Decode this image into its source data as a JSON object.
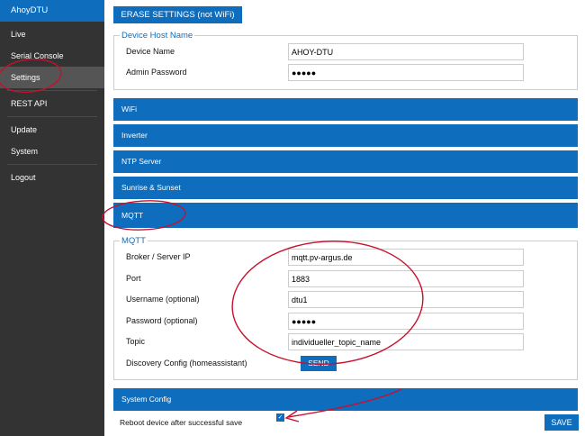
{
  "sidebar": {
    "brand": "AhoyDTU",
    "items": [
      {
        "label": "Live"
      },
      {
        "label": "Serial Console"
      },
      {
        "label": "Settings"
      },
      {
        "label": "REST API"
      },
      {
        "label": "Update"
      },
      {
        "label": "System"
      },
      {
        "label": "Logout"
      }
    ]
  },
  "toolbar": {
    "erase_label": "ERASE SETTINGS (not WiFi)"
  },
  "device": {
    "legend": "Device Host Name",
    "name_label": "Device Name",
    "name_value": "AHOY-DTU",
    "password_label": "Admin Password",
    "password_value": "●●●●●"
  },
  "sections": {
    "wifi": "WiFi",
    "inverter": "Inverter",
    "ntp": "NTP Server",
    "sunrise": "Sunrise & Sunset",
    "mqtt": "MQTT",
    "system": "System Config"
  },
  "mqtt": {
    "legend": "MQTT",
    "broker_label": "Broker / Server IP",
    "broker_value": "mqtt.pv-argus.de",
    "port_label": "Port",
    "port_value": "1883",
    "user_label": "Username (optional)",
    "user_value": "dtu1",
    "pass_label": "Password (optional)",
    "pass_value": "●●●●●",
    "topic_label": "Topic",
    "topic_value": "individueller_topic_name",
    "discovery_label": "Discovery Config (homeassistant)",
    "send_label": "SEND"
  },
  "footer": {
    "reboot_label": "Reboot device after successful save",
    "reboot_checked": "✓",
    "save_label": "SAVE"
  },
  "colors": {
    "accent": "#0e6dbd",
    "sidebar": "#333333",
    "annotation": "#c8102e"
  }
}
